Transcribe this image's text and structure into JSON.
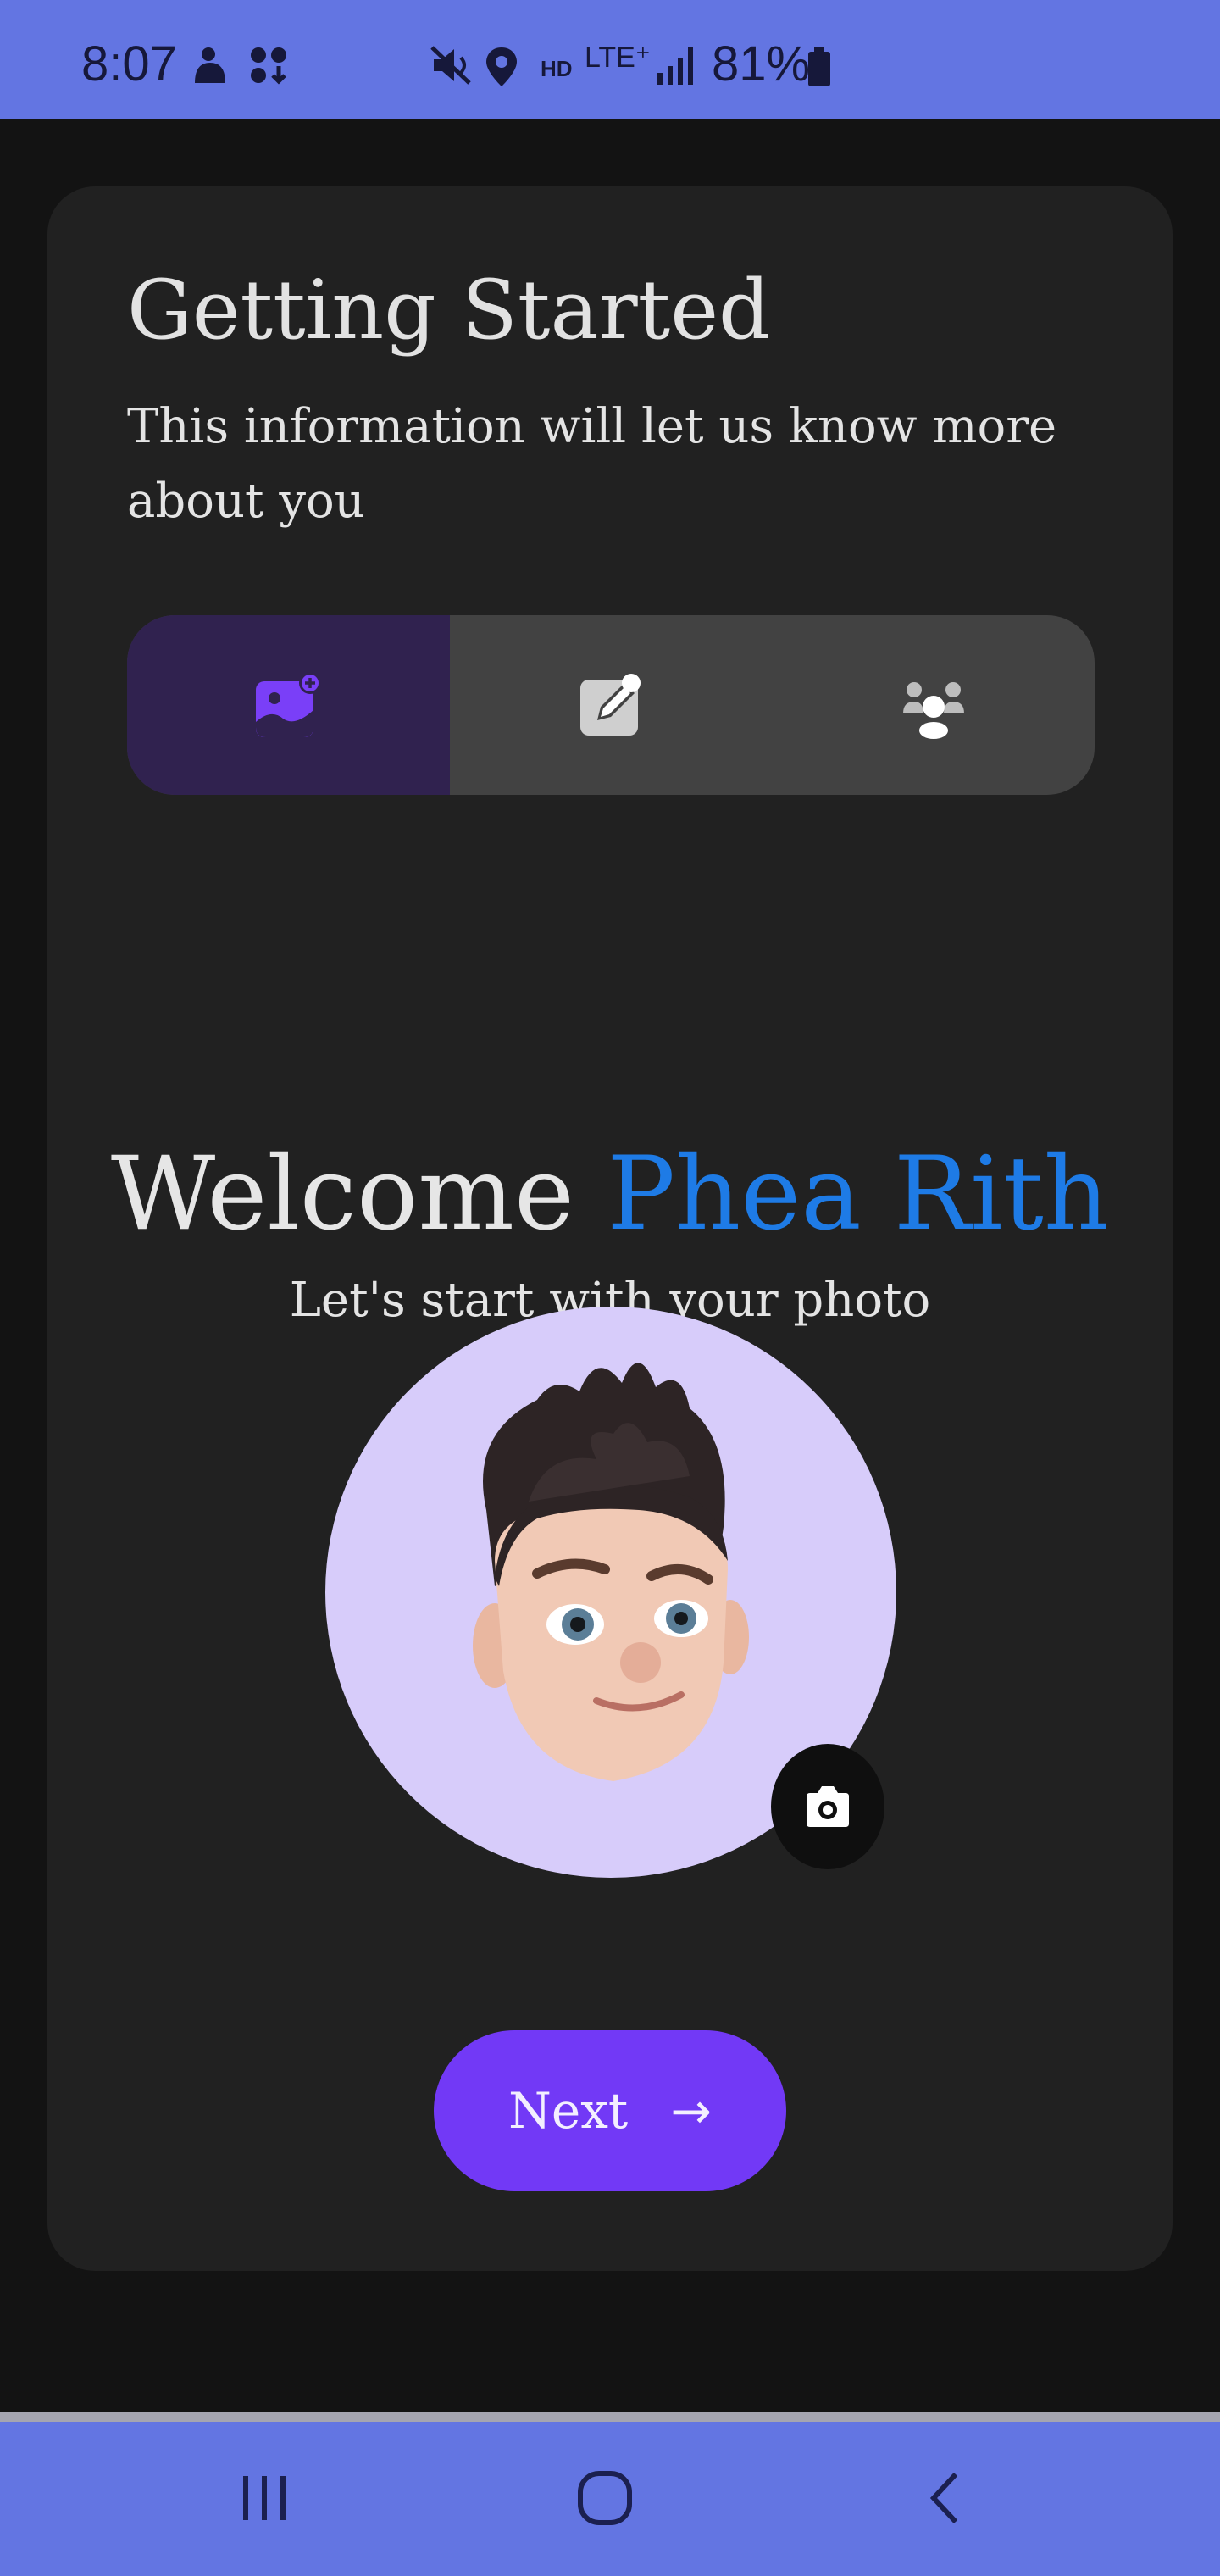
{
  "status_bar": {
    "time": "8:07",
    "network_label": "HD",
    "lte_label": "LTE⁺",
    "battery_percent": "81%",
    "icons": [
      "notification-icon",
      "apps-download-icon",
      "mute-icon",
      "location-icon",
      "signal-icon",
      "battery-icon"
    ]
  },
  "card": {
    "title": "Getting Started",
    "subtitle": "This information will let us know more about you"
  },
  "tabs": [
    {
      "icon": "add-photo-icon",
      "active": true
    },
    {
      "icon": "edit-note-icon",
      "active": false
    },
    {
      "icon": "group-icon",
      "active": false
    }
  ],
  "welcome": {
    "greeting": "Welcome",
    "name": "Phea Rith",
    "lead": "Let's start with your photo"
  },
  "avatar": {
    "icon": "camera-icon"
  },
  "next_button": {
    "label": "Next",
    "arrow": "→"
  },
  "nav_bar": {
    "icons": [
      "recent-apps-icon",
      "home-icon",
      "back-icon"
    ]
  },
  "colors": {
    "status_bar": "#6375e2",
    "card": "#212121",
    "accent": "#7239f6",
    "name_highlight": "#1e7be6",
    "avatar_bg": "#d7ccfa"
  }
}
